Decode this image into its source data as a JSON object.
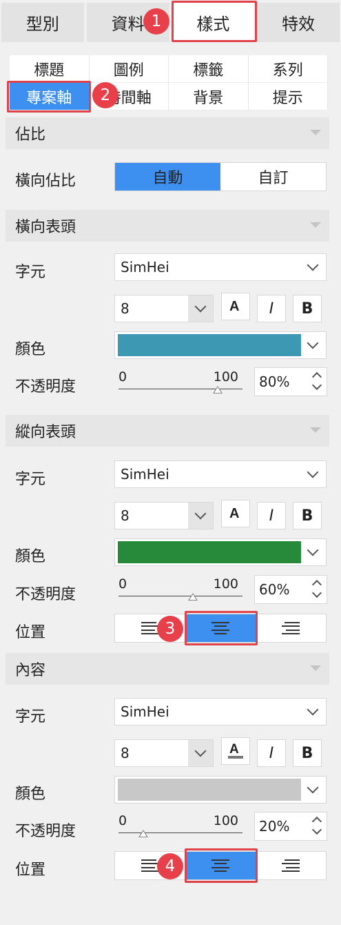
{
  "top_tabs": [
    "型別",
    "資料",
    "樣式",
    "特效"
  ],
  "sub_tabs": [
    "標題",
    "圖例",
    "標籤",
    "系列",
    "專案軸",
    "時間軸",
    "背景",
    "提示"
  ],
  "badges": [
    "1",
    "2",
    "3",
    "4"
  ],
  "ratio": {
    "section_title": "佔比",
    "label": "橫向佔比",
    "options": [
      "自動",
      "自訂"
    ],
    "selected": "自動"
  },
  "horizontal_header": {
    "section_title": "橫向表頭",
    "font_label": "字元",
    "font": "SimHei",
    "size": "8",
    "bold": "B",
    "italic": "I",
    "color_label": "顏色",
    "color": "#3d98b4",
    "opacity_label": "不透明度",
    "slider_min": "0",
    "slider_max": "100",
    "opacity": "80%",
    "opacity_value": 0.8
  },
  "vertical_header": {
    "section_title": "縱向表頭",
    "font_label": "字元",
    "font": "SimHei",
    "size": "8",
    "bold": "B",
    "italic": "I",
    "color_label": "顏色",
    "color": "#278a3a",
    "opacity_label": "不透明度",
    "slider_min": "0",
    "slider_max": "100",
    "opacity": "60%",
    "opacity_value": 0.6,
    "position_label": "位置",
    "position_selected": "center"
  },
  "content": {
    "section_title": "內容",
    "font_label": "字元",
    "font": "SimHei",
    "size": "8",
    "bold": "B",
    "italic": "I",
    "color_label": "顏色",
    "color": "#c8c8c8",
    "opacity_label": "不透明度",
    "slider_min": "0",
    "slider_max": "100",
    "opacity": "20%",
    "opacity_value": 0.2,
    "position_label": "位置",
    "position_selected": "center"
  },
  "accent_color": "#3d8ff0",
  "highlight_color": "#e0424a"
}
